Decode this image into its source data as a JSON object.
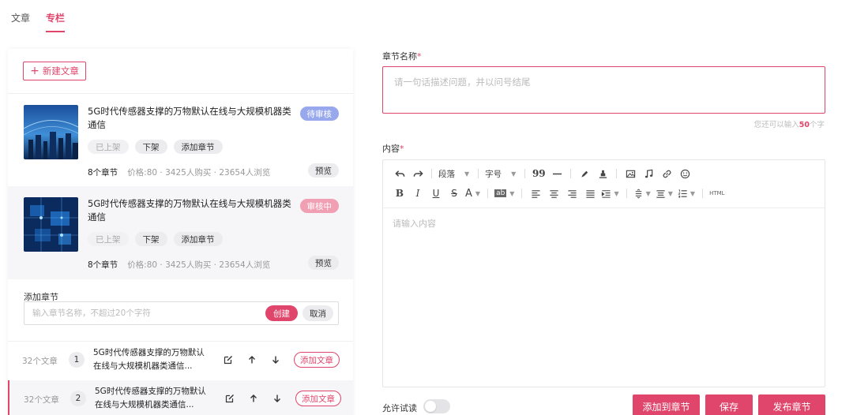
{
  "tabs": [
    {
      "label": "文章",
      "active": false
    },
    {
      "label": "专栏",
      "active": true
    }
  ],
  "left": {
    "new_article_label": "新建文章",
    "articles": [
      {
        "title": "5G时代传感器支撑的万物默认在线与大规模机器类通信",
        "status": "待审核",
        "actions": [
          "已上架",
          "下架",
          "添加章节"
        ],
        "chapters": "8个章节",
        "meta": "价格:80 · 3425人购买 · 23654人浏览",
        "preview_label": "预览"
      },
      {
        "title": "5G时代传感器支撑的万物默认在线与大规模机器类通信",
        "status": "审核中",
        "actions": [
          "已上架",
          "下架",
          "添加章节"
        ],
        "chapters": "8个章节",
        "meta": "价格:80 · 3425人购买 · 23654人浏览",
        "preview_label": "预览"
      }
    ],
    "add_chapter": {
      "label": "添加章节",
      "placeholder": "输入章节名称，不超过20个字符",
      "create_label": "创建",
      "cancel_label": "取消"
    },
    "chapter_rows": [
      {
        "count": "32个文章",
        "index": "1",
        "title": "5G时代传感器支撑的万物默认在线与大规模机器类通信...",
        "add_label": "添加文章"
      },
      {
        "count": "32个文章",
        "index": "2",
        "title": "5G时代传感器支撑的万物默认在线与大规模机器类通信...",
        "add_label": "添加文章"
      }
    ]
  },
  "form": {
    "name_label": "章节名称",
    "required_mark": "*",
    "name_placeholder": "请一句话描述问题，并以问号结尾",
    "hint_prefix": "您还可以输入",
    "hint_num": "50",
    "hint_suffix": "个字",
    "content_label": "内容",
    "toolbar": {
      "paragraph": "段落",
      "font_size": "字号",
      "quote": "99",
      "bold": "B",
      "italic": "I",
      "underline": "U",
      "strike": "S",
      "font_color": "A",
      "bg_color": "ab",
      "html": "HTML"
    },
    "content_placeholder": "请输入内容",
    "allow_trial_label": "允许试读",
    "buttons": {
      "add_to_chapter": "添加到章节",
      "save": "保存",
      "publish": "发布章节"
    }
  },
  "colors": {
    "accent": "#e0456b",
    "badge_pending": "#97a9ec",
    "badge_reviewing": "#f19fb3"
  }
}
